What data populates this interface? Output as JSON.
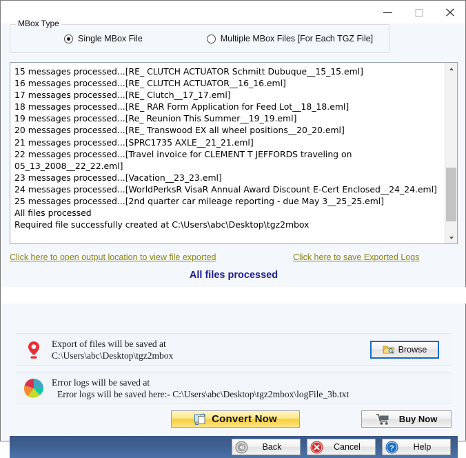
{
  "window": {
    "controls": {
      "minimize": "minimize-button",
      "maximize": "maximize-button",
      "close": "close-button"
    }
  },
  "mbox_type": {
    "legend": "MBox Type",
    "options": [
      {
        "label": "Single MBox File",
        "selected": true
      },
      {
        "label": "Multiple MBox Files [For Each TGZ File]",
        "selected": false
      }
    ]
  },
  "log": {
    "text": "15 messages processed...[RE_ CLUTCH ACTUATOR Schmitt Dubuque__15_15.eml]\n16 messages processed...[RE_ CLUTCH ACTUATOR__16_16.eml]\n17 messages processed...[RE_ Clutch__17_17.eml]\n18 messages processed...[RE_ RAR Form Application for Feed Lot__18_18.eml]\n19 messages processed...[Re_ Reunion This Summer__19_19.eml]\n20 messages processed...[RE_ Transwood EX all wheel positions__20_20.eml]\n21 messages processed...[SPRC1735 AXLE__21_21.eml]\n22 messages processed...[Travel invoice for CLEMENT T JEFFORDS traveling on 05_13_2008__22_22.eml]\n23 messages processed...[Vacation__23_23.eml]\n24 messages processed...[WorldPerksR VisaR Annual Award Discount E-Cert Enclosed__24_24.eml]\n25 messages processed...[2nd quarter car mileage reporting - due May 3__25_25.eml]\nAll files processed\nRequired file successfully created at C:\\Users\\abc\\Desktop\\tgz2mbox",
    "scroll_up_icon": "scroll-up-arrow-icon",
    "scroll_down_icon": "scroll-down-arrow-icon"
  },
  "links": {
    "open_output": "Click here to open output location to view file exported",
    "save_logs": "Click here to save Exported Logs",
    "color": "#8a8415"
  },
  "status": {
    "text": "All files processed",
    "color": "#1d1d8c"
  },
  "export_row": {
    "icon": "location-pin-icon",
    "line1": "Export of files will be saved at",
    "line2": "C:\\Users\\abc\\Desktop\\tgz2mbox",
    "browse_label": "Browse",
    "browse_icon": "folder-search-icon"
  },
  "error_row": {
    "icon": "pie-chart-icon",
    "line1": "Error logs will be saved at",
    "line2": " Error logs will be saved here:- C:\\Users\\abc\\Desktop\\tgz2mbox\\logFile_3b.txt"
  },
  "actions": {
    "convert": {
      "label": "Convert Now",
      "icon": "convert-files-icon"
    },
    "buy": {
      "label": "Buy Now",
      "icon": "shopping-cart-icon"
    }
  },
  "footer": {
    "buttons": [
      {
        "label": "Back",
        "icon": "rewind-icon"
      },
      {
        "label": "Cancel",
        "icon": "cancel-x-icon"
      },
      {
        "label": "Help",
        "icon": "question-mark-icon"
      }
    ]
  }
}
